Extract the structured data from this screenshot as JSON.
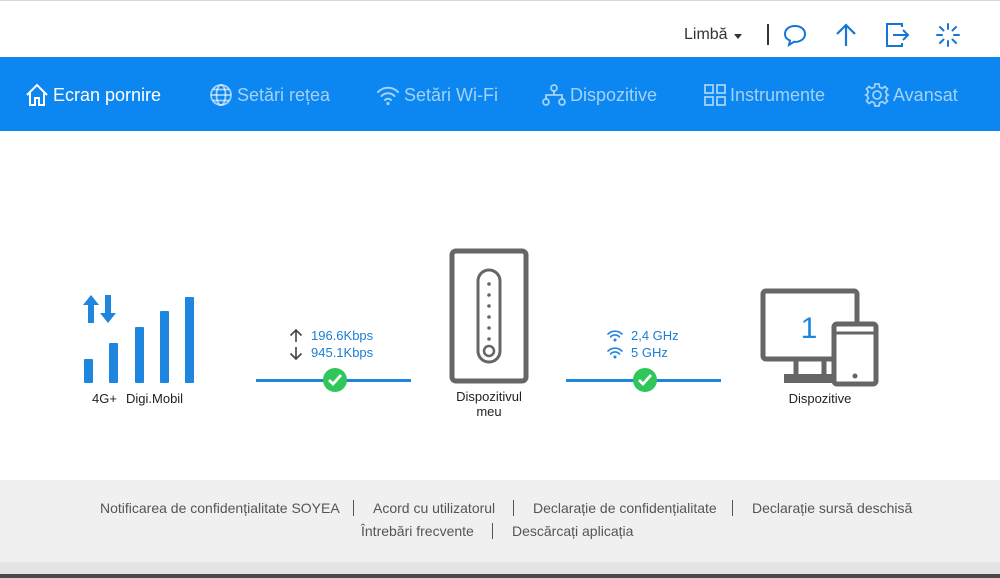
{
  "topbar": {
    "language_label": "Limbă",
    "icons": [
      "chat-icon",
      "upload-icon",
      "logout-icon",
      "loading-icon"
    ]
  },
  "nav": {
    "items": [
      {
        "label": "Ecran pornire",
        "icon": "home-icon",
        "active": true
      },
      {
        "label": "Setări rețea",
        "icon": "globe-icon",
        "active": false
      },
      {
        "label": "Setări Wi-Fi",
        "icon": "wifi-icon",
        "active": false
      },
      {
        "label": "Dispozitive",
        "icon": "network-icon",
        "active": false
      },
      {
        "label": "Instrumente",
        "icon": "grid-icon",
        "active": false
      },
      {
        "label": "Avansat",
        "icon": "gear-icon",
        "active": false
      }
    ]
  },
  "status": {
    "network_type": "4G+",
    "operator": "Digi.Mobil",
    "upload_rate": "196.6Kbps",
    "download_rate": "945.1Kbps",
    "device_label": "Dispozitivul meu",
    "wifi_24": "2,4 GHz",
    "wifi_5": "5 GHz",
    "connected_count": "1",
    "connected_label": "Dispozitive"
  },
  "footer": {
    "links_row1": [
      "Notificarea de confidențialitate SOYEA",
      "Acord cu utilizatorul",
      "Declarație de confidențialitate",
      "Declarație sursă deschisă"
    ],
    "links_row2": [
      "Întrebări frecvente",
      "Descărcați aplicația"
    ]
  },
  "colors": {
    "nav_bg": "#0c86f0",
    "accent": "#1f86e0",
    "ok": "#2fc65a",
    "device_gray": "#666666"
  }
}
